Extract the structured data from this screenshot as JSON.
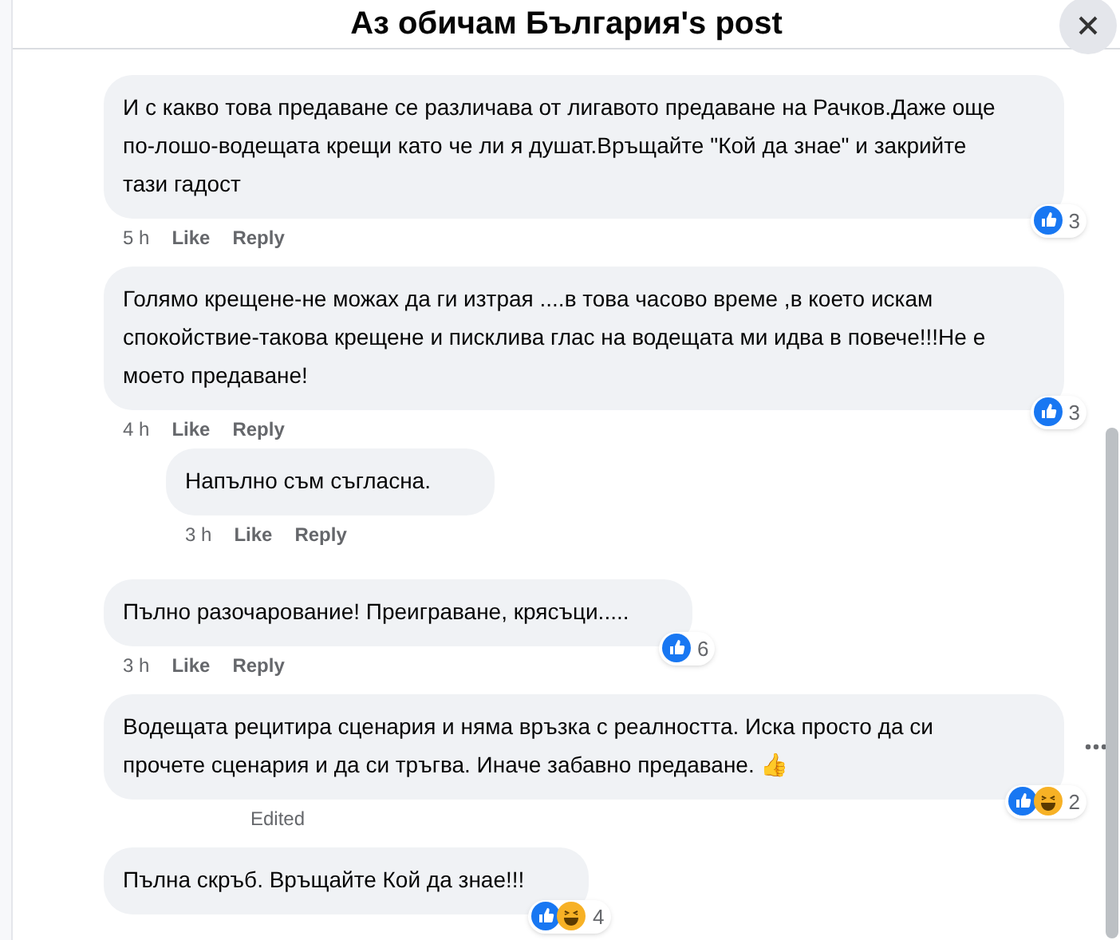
{
  "title": "Аз обичам България's post",
  "comments": [
    {
      "text": "И с какво това предаване се различава от лигавото предаване на Рачков.Даже още по-лошо-водещата крещи като че ли я душат.Връщайте \"Кой да знае\" и закрийте тази гадост",
      "time": "5 h",
      "like": "Like",
      "reply": "Reply",
      "reactions": [
        {
          "kind": "like"
        }
      ],
      "count": "3"
    },
    {
      "text": "Голямо крещене-не можах да ги изтрая ....в това часово време ,в което искам спокойствие-такова крещене и писклива глас на водещата ми идва в повече!!!Не е моето предаване!",
      "time": "4 h",
      "like": "Like",
      "reply": "Reply",
      "reactions": [
        {
          "kind": "like"
        }
      ],
      "count": "3",
      "children": [
        {
          "text": "Напълно съм съгласна.",
          "time": "3 h",
          "like": "Like",
          "reply": "Reply"
        }
      ]
    },
    {
      "text": "Пълно разочарование! Преиграване, крясъци.....",
      "time": "3 h",
      "like": "Like",
      "reply": "Reply",
      "reactions": [
        {
          "kind": "like"
        }
      ],
      "count": "6"
    },
    {
      "text": "Водещата рецитира сценария и няма връзка с реалността. Иска просто да си прочете сценария и да си тръгва. Иначе забавно предаване. 👍",
      "edited": "Edited",
      "reactions": [
        {
          "kind": "like"
        },
        {
          "kind": "haha"
        }
      ],
      "count": "2",
      "menu": true
    },
    {
      "text": "Пълна скръб. Връщайте Кой да знае!!!",
      "reactions": [
        {
          "kind": "like"
        },
        {
          "kind": "haha"
        }
      ],
      "count": "4"
    }
  ]
}
